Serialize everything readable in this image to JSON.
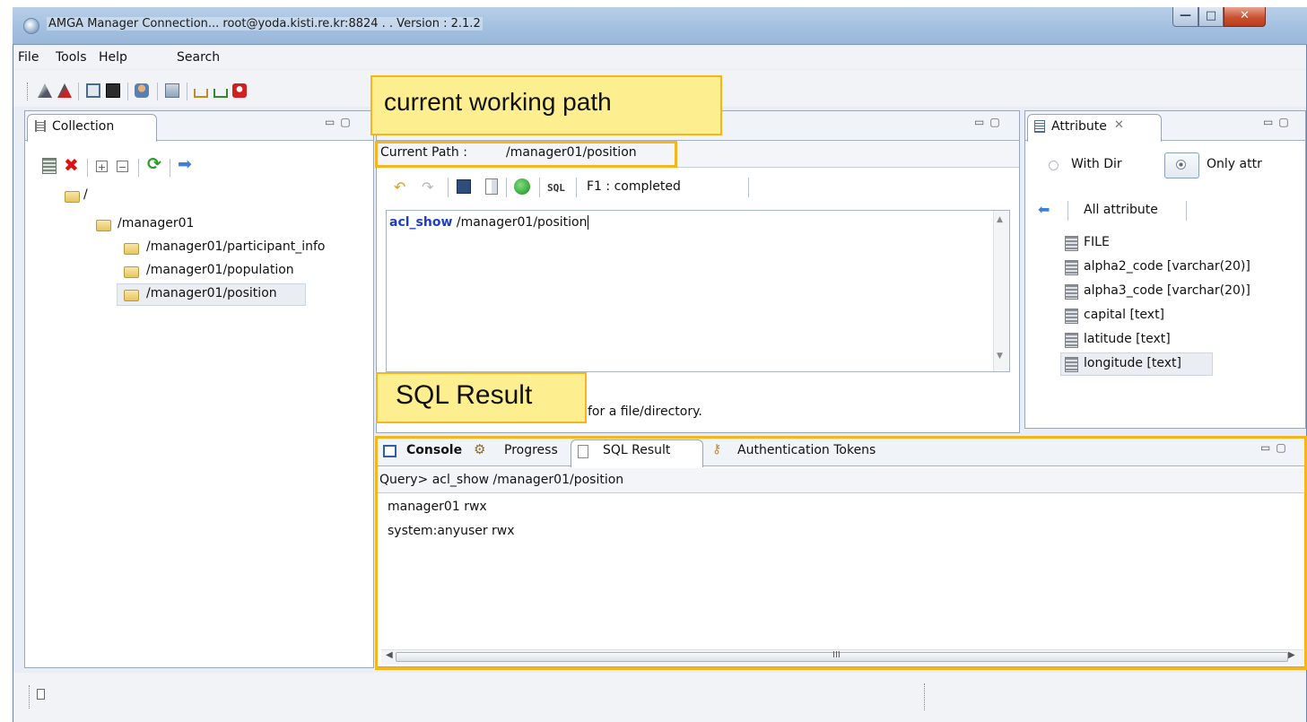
{
  "window": {
    "title": "AMGA Manager Connection... root@yoda.kisti.re.kr:8824 . . Version : 2.1.2"
  },
  "menu": {
    "items": [
      "File",
      "Tools",
      "Help",
      "Search"
    ]
  },
  "collection_panel": {
    "tab_label": "Collection",
    "tree": [
      {
        "label": "/"
      },
      {
        "label": "/manager01"
      },
      {
        "label": "/manager01/participant_info"
      },
      {
        "label": "/manager01/population"
      },
      {
        "label": "/manager01/position",
        "selected": true
      }
    ]
  },
  "editor": {
    "current_path_label": "Current Path :",
    "current_path_value": "/manager01/position",
    "sql_button": "SQL",
    "status": "F1 : completed",
    "command_keyword": "acl_show",
    "command_arg": " /manager01/position",
    "hint_text": "for a file/directory."
  },
  "attribute_panel": {
    "tab_label": "Attribute",
    "radio_with_dir": "With Dir",
    "radio_only_attr": "Only attr",
    "all_attribute_button": "All attribute",
    "items": [
      "FILE",
      "alpha2_code [varchar(20)]",
      "alpha3_code [varchar(20)]",
      "capital [text]",
      "latitude [text]",
      "longitude [text]"
    ]
  },
  "bottom_panel": {
    "tabs": [
      "Console",
      "Progress",
      "SQL Result",
      "Authentication Tokens"
    ],
    "query_line": "Query> acl_show /manager01/position",
    "results": [
      "manager01 rwx",
      "system:anyuser rwx"
    ],
    "scroll_mark": "III"
  },
  "annotations": {
    "working_path": "current working path",
    "sql_result": "SQL Result"
  },
  "colors": {
    "highlight": "#f6b51a",
    "annotation_fill": "#fdef8f",
    "keyword": "#1e3fc0"
  }
}
